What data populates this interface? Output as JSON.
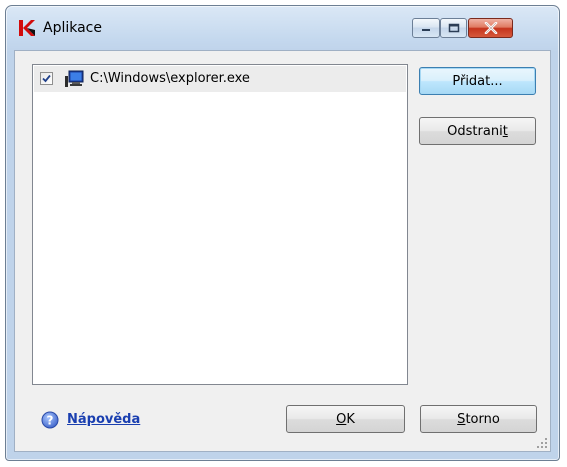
{
  "window": {
    "title": "Aplikace",
    "accent": "#c5341c",
    "caption_bg": "#c4d8ee"
  },
  "caption_buttons": {
    "minimize_icon": "minimize-icon",
    "maximize_icon": "maximize-icon",
    "close_icon": "close-icon"
  },
  "app_list": {
    "items": [
      {
        "checked": true,
        "icon": "computer-icon",
        "label": "C:\\Windows\\explorer.exe"
      }
    ]
  },
  "buttons": {
    "add": {
      "label": "Přidat...",
      "default": true
    },
    "remove": {
      "label_before": "Odstrani",
      "label_accel": "t",
      "label_after": ""
    },
    "ok": {
      "label_before": "",
      "label_accel": "O",
      "label_after": "K"
    },
    "cancel": {
      "label_before": "",
      "label_accel": "S",
      "label_after": "torno"
    }
  },
  "help": {
    "icon": "help-icon",
    "label": "Nápověda",
    "color": "#1a3fb0"
  }
}
